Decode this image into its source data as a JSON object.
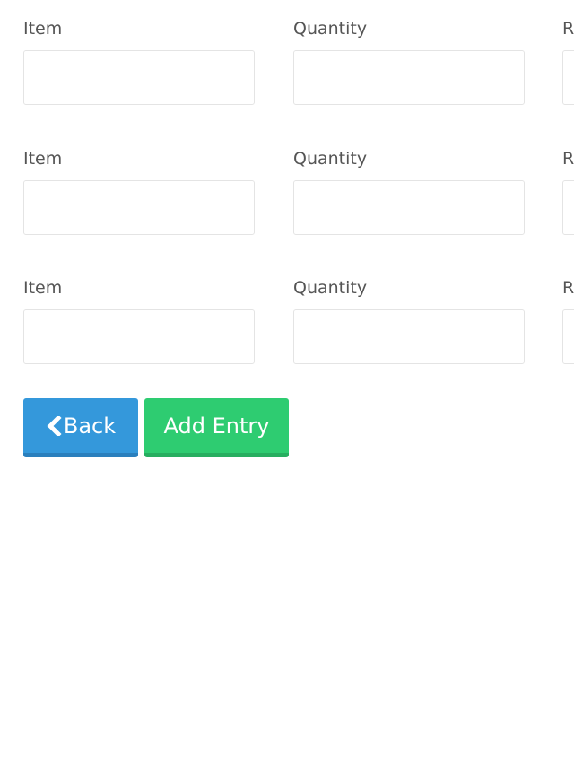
{
  "form": {
    "rows": [
      {
        "fields": [
          {
            "label": "Item",
            "value": "",
            "placeholder": ""
          },
          {
            "label": "Quantity",
            "value": "",
            "placeholder": ""
          },
          {
            "label": "R",
            "value": "",
            "placeholder": ""
          }
        ]
      },
      {
        "fields": [
          {
            "label": "Item",
            "value": "",
            "placeholder": ""
          },
          {
            "label": "Quantity",
            "value": "",
            "placeholder": ""
          },
          {
            "label": "R",
            "value": "",
            "placeholder": ""
          }
        ]
      },
      {
        "fields": [
          {
            "label": "Item",
            "value": "",
            "placeholder": ""
          },
          {
            "label": "Quantity",
            "value": "",
            "placeholder": ""
          },
          {
            "label": "R",
            "value": "",
            "placeholder": ""
          }
        ]
      }
    ]
  },
  "actions": {
    "back_label": "Back",
    "back_icon": "chevron-left-icon",
    "add_label": "Add Entry",
    "colors": {
      "back": "#3498db",
      "add": "#2ecc71"
    }
  }
}
